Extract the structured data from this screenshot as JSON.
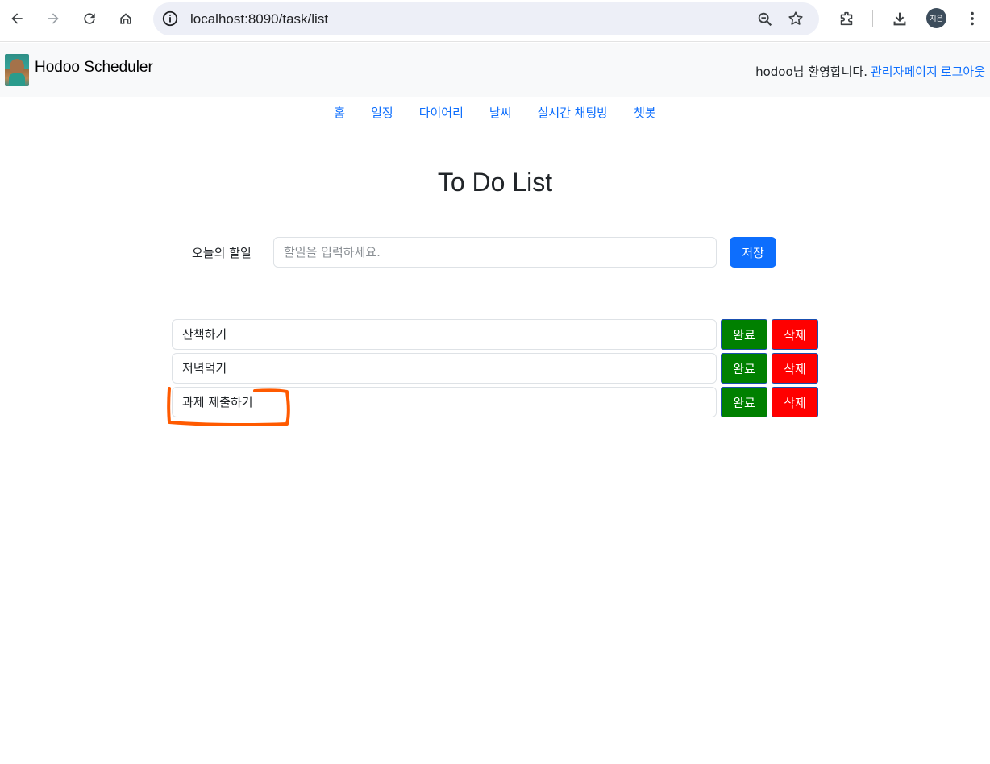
{
  "browser": {
    "url": "localhost:8090/task/list",
    "profile_initials": "지은"
  },
  "header": {
    "brand": "Hodoo Scheduler",
    "welcome_text": "hodoo님 환영합니다.",
    "admin_link": "관리자페이지",
    "logout_link": "로그아웃"
  },
  "nav": {
    "items": [
      {
        "label": "홈"
      },
      {
        "label": "일정"
      },
      {
        "label": "다이어리"
      },
      {
        "label": "날씨"
      },
      {
        "label": "실시간 채팅방"
      },
      {
        "label": "챗봇"
      }
    ]
  },
  "main": {
    "title": "To Do List",
    "input_label": "오늘의 할일",
    "input_placeholder": "할일을 입력하세요.",
    "input_value": "",
    "save_label": "저장"
  },
  "tasks": [
    {
      "text": "산책하기",
      "done_label": "완료",
      "delete_label": "삭제"
    },
    {
      "text": "저녁먹기",
      "done_label": "완료",
      "delete_label": "삭제"
    },
    {
      "text": "과제 제출하기",
      "done_label": "완료",
      "delete_label": "삭제"
    }
  ],
  "colors": {
    "primary": "#0d6efd",
    "done": "#008000",
    "delete": "#ff0000",
    "annotation": "#ff5a00"
  }
}
